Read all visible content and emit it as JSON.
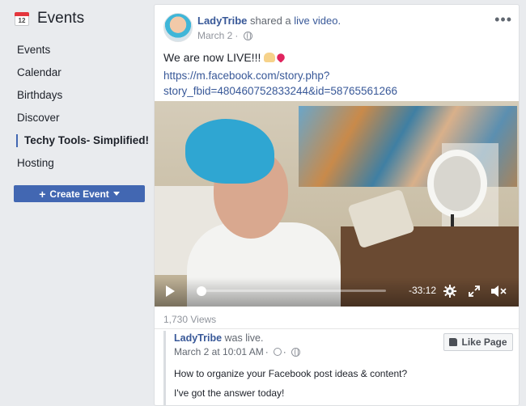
{
  "sidebar": {
    "title": "Events",
    "calendar_day": "12",
    "items": [
      {
        "label": "Events"
      },
      {
        "label": "Calendar"
      },
      {
        "label": "Birthdays"
      },
      {
        "label": "Discover"
      },
      {
        "label": "Techy Tools- Simplified!"
      },
      {
        "label": "Hosting"
      }
    ],
    "create_button": "Create Event"
  },
  "post": {
    "author": "LadyTribe",
    "action_prefix": "shared a",
    "action_link": "live video.",
    "date": "March 2",
    "text": "We are now LIVE!!!",
    "url_line1": "https://m.facebook.com/story.php?",
    "url_line2": "story_fbid=480460752833244&id=58765561266",
    "views": "1,730 Views"
  },
  "video": {
    "time_remaining": "-33:12",
    "progress": 0.02
  },
  "shared": {
    "author": "LadyTribe",
    "status": "was live.",
    "date": "March 2 at 10:01 AM",
    "like_page": "Like Page",
    "text1": "How to organize your Facebook post ideas & content?",
    "text2": "I've got the answer today!"
  },
  "colors": {
    "link": "#385898",
    "primary_button": "#4267b2",
    "background": "#e9ebee"
  }
}
